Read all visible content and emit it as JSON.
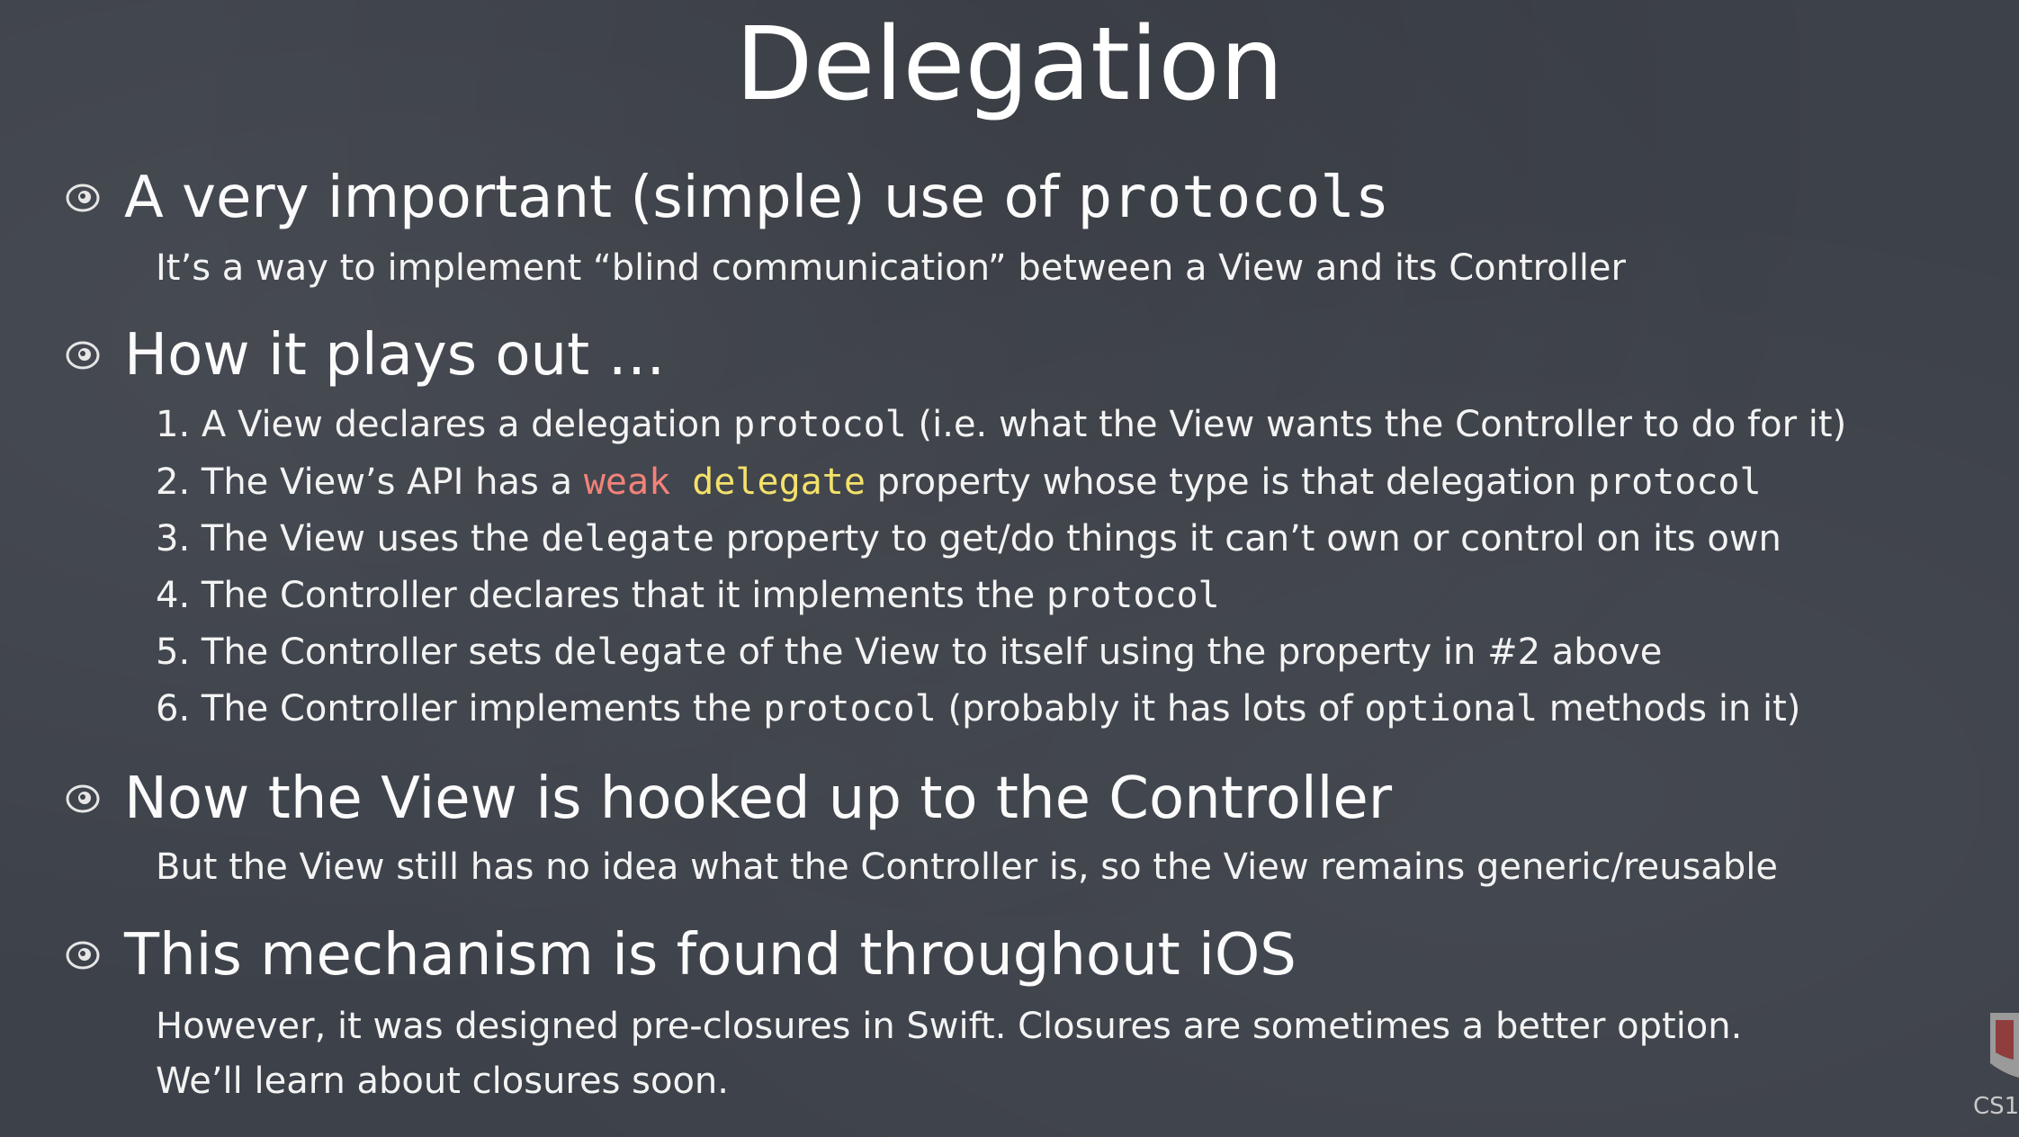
{
  "title": "Delegation",
  "icons": {
    "bullet": "eye-bullet-icon",
    "logo": "stanford-logo"
  },
  "colors": {
    "background": "#3d4149",
    "text": "#f2f2f2",
    "weak": "#f2827a",
    "delegate": "#f3e16a"
  },
  "b1": {
    "text": "A very important (simple) use of ",
    "code": "protocols"
  },
  "b1_sub": "It’s a way to implement “blind communication” between a View and its Controller",
  "b2": "How it plays out …",
  "s1": {
    "a": "1. A View declares a delegation ",
    "code": "protocol",
    "b": " (i.e. what the View wants the Controller to do for it)"
  },
  "s2": {
    "a": "2. The View’s API has a ",
    "weak": "weak",
    "space": " ",
    "delegate": "delegate",
    "b": " property whose type is that delegation ",
    "code": "protocol"
  },
  "s3": {
    "a": "3. The View uses the ",
    "code": "delegate",
    "b": " property to get/do things it can’t own or control on its own"
  },
  "s4": {
    "a": "4. The Controller declares that it implements the ",
    "code": "protocol"
  },
  "s5": {
    "a": "5. The Controller sets ",
    "code1": "delegate",
    "b": " of the View to itself using the property in #2 above"
  },
  "s6": {
    "a": "6. The Controller implements the ",
    "code1": "protocol",
    "b": " (probably it has lots of ",
    "code2": "optional",
    "c": " methods in it)"
  },
  "b3": "Now the View is hooked up to the Controller",
  "b3_sub": "But the View still has no idea what the Controller is, so the View remains generic/reusable",
  "b4": "This mechanism is found throughout iOS",
  "b4_sub1": "However, it was designed pre-closures in Swift.  Closures are sometimes a better option.",
  "b4_sub2": "We’ll learn about closures soon.",
  "logo_text": "CS1"
}
